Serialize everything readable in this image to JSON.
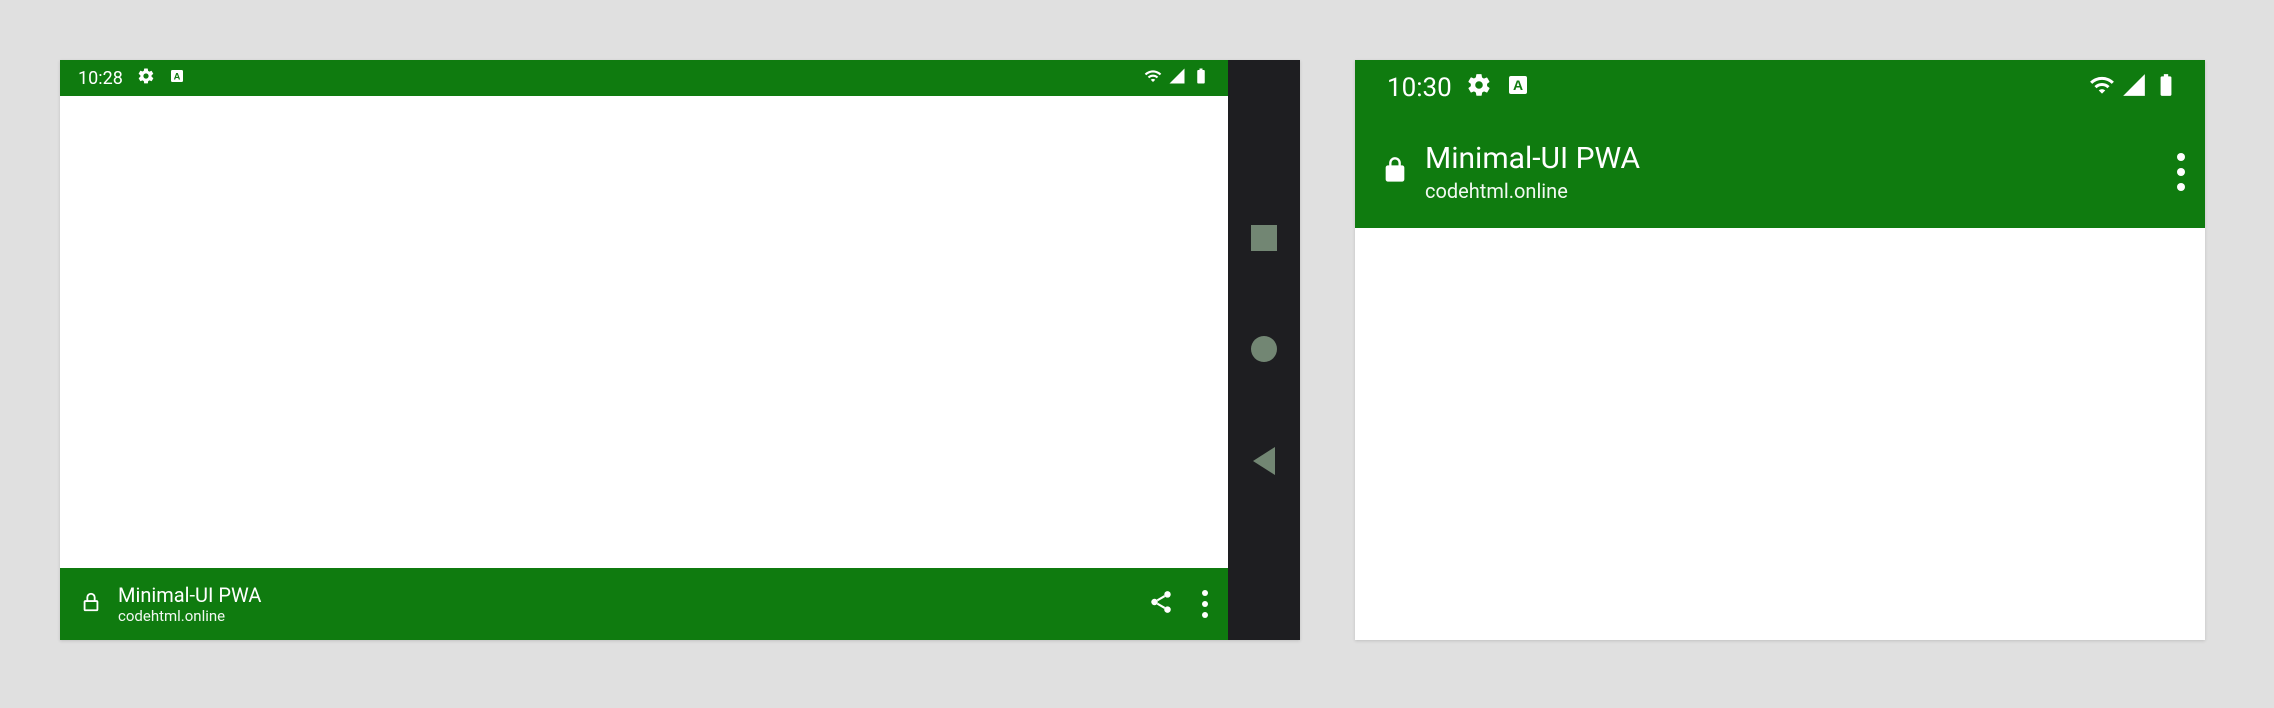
{
  "left": {
    "status": {
      "time": "10:28"
    },
    "appbar": {
      "title": "Minimal-UI PWA",
      "subtitle": "codehtml.online"
    }
  },
  "right": {
    "status": {
      "time": "10:30"
    },
    "appbar": {
      "title": "Minimal-UI PWA",
      "subtitle": "codehtml.online"
    }
  },
  "colors": {
    "theme": "#0f7b0f",
    "navbar": "#1e1e21",
    "page_bg": "#e0e0e0"
  }
}
